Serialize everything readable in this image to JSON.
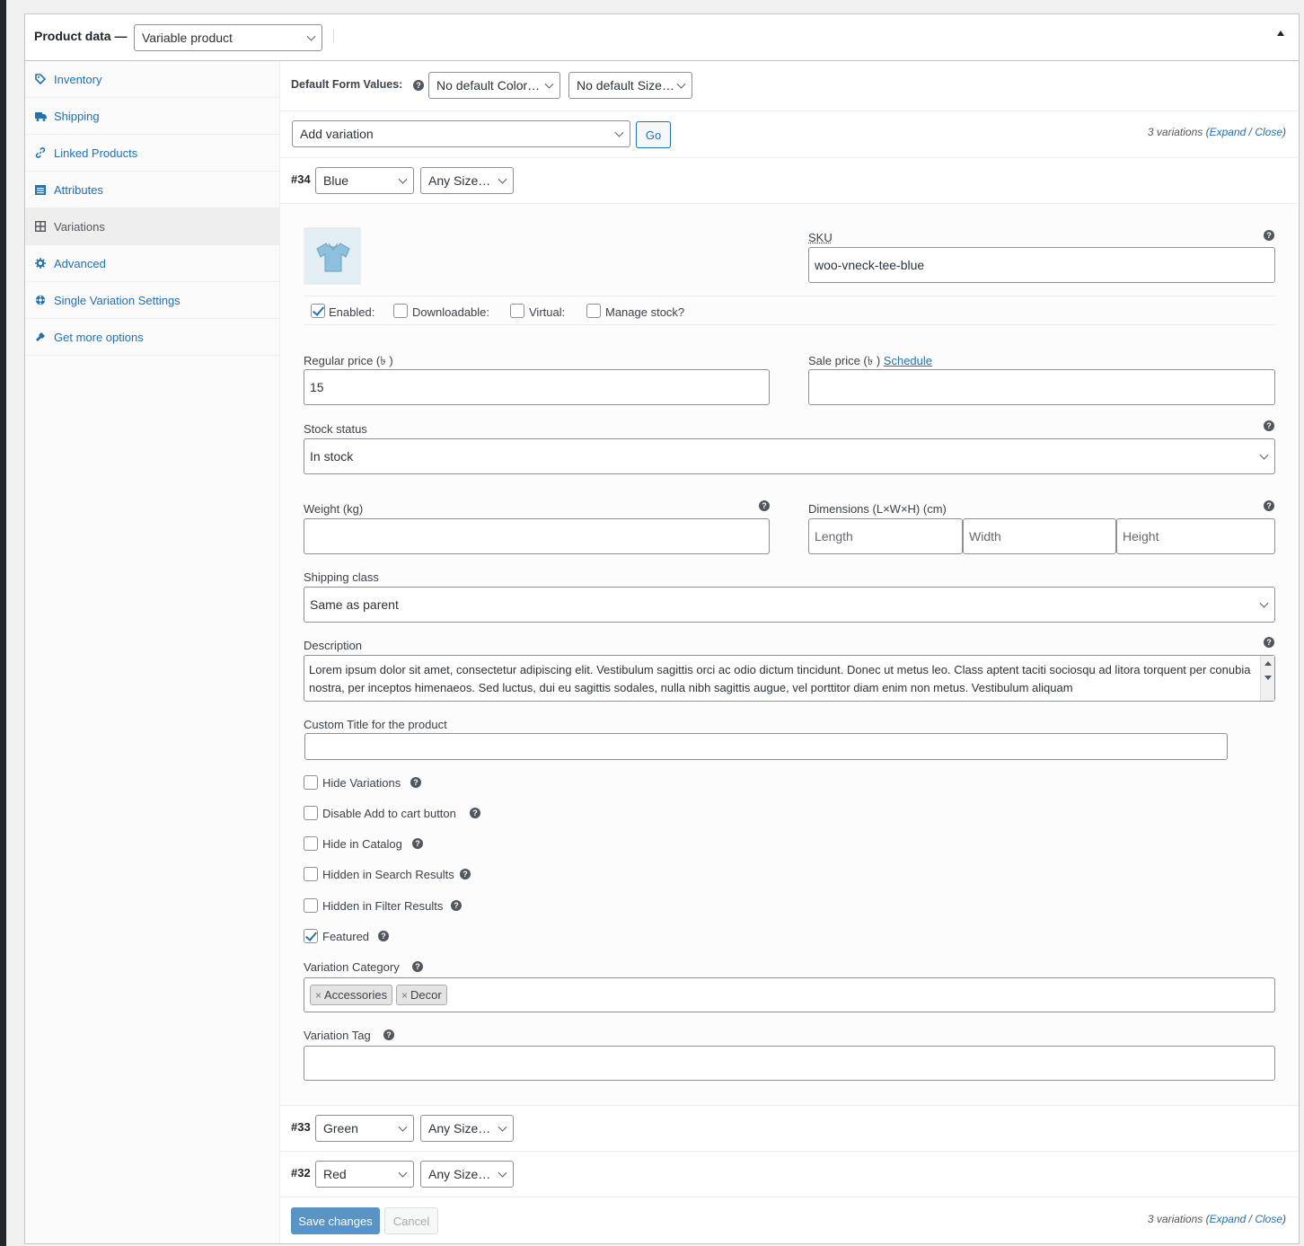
{
  "header": {
    "title": "Product data —",
    "product_type": "Variable product"
  },
  "tabs": [
    {
      "label": "Inventory",
      "icon": "tag-icon"
    },
    {
      "label": "Shipping",
      "icon": "truck-icon"
    },
    {
      "label": "Linked Products",
      "icon": "link-icon"
    },
    {
      "label": "Attributes",
      "icon": "list-icon"
    },
    {
      "label": "Variations",
      "icon": "grid-icon"
    },
    {
      "label": "Advanced",
      "icon": "gear-icon"
    },
    {
      "label": "Single Variation Settings",
      "icon": "cog-icon"
    },
    {
      "label": "Get more options",
      "icon": "plugin-icon"
    }
  ],
  "defaults": {
    "label": "Default Form Values:",
    "color": "No default Color…",
    "size": "No default Size…"
  },
  "actions": {
    "add_variation": "Add variation",
    "go": "Go",
    "count": "3 variations (",
    "expand": "Expand",
    "slash": " / ",
    "close": "Close",
    "close_paren": ")"
  },
  "variations": [
    {
      "id": "#34",
      "color": "Blue",
      "size": "Any Size…"
    },
    {
      "id": "#33",
      "color": "Green",
      "size": "Any Size…"
    },
    {
      "id": "#32",
      "color": "Red",
      "size": "Any Size…"
    }
  ],
  "form": {
    "sku_label": "SKU",
    "sku_value": "woo-vneck-tee-blue",
    "enabled": "Enabled:",
    "downloadable": "Downloadable:",
    "virtual": "Virtual:",
    "manage_stock": "Manage stock?",
    "regular_price_label": "Regular price (৳ )",
    "regular_price_value": "15",
    "sale_price_label": "Sale price (৳ )",
    "schedule": "Schedule",
    "stock_status_label": "Stock status",
    "stock_status_value": "In stock",
    "weight_label": "Weight (kg)",
    "dimensions_label": "Dimensions (L×W×H) (cm)",
    "length_ph": "Length",
    "width_ph": "Width",
    "height_ph": "Height",
    "shipping_class_label": "Shipping class",
    "shipping_class_value": "Same as parent",
    "description_label": "Description",
    "description_value": "Lorem ipsum dolor sit amet, consectetur adipiscing elit. Vestibulum sagittis orci ac odio dictum tincidunt. Donec ut metus leo. Class aptent taciti sociosqu ad litora torquent per conubia nostra, per inceptos himenaeos. Sed luctus, dui eu sagittis sodales, nulla nibh sagittis augue, vel porttitor diam enim non metus. Vestibulum aliquam",
    "custom_title_label": "Custom Title for the product",
    "hide_variations": "Hide Variations",
    "disable_add_to_cart": "Disable Add to cart button",
    "hide_in_catalog": "Hide in Catalog",
    "hidden_in_search": "Hidden in Search Results",
    "hidden_in_filter": "Hidden in Filter Results",
    "featured": "Featured",
    "variation_category_label": "Variation Category",
    "categories": [
      "Accessories",
      "Decor"
    ],
    "variation_tag_label": "Variation Tag"
  },
  "footer": {
    "save": "Save changes",
    "cancel": "Cancel"
  },
  "colors": {
    "accent": "#2271b1"
  }
}
